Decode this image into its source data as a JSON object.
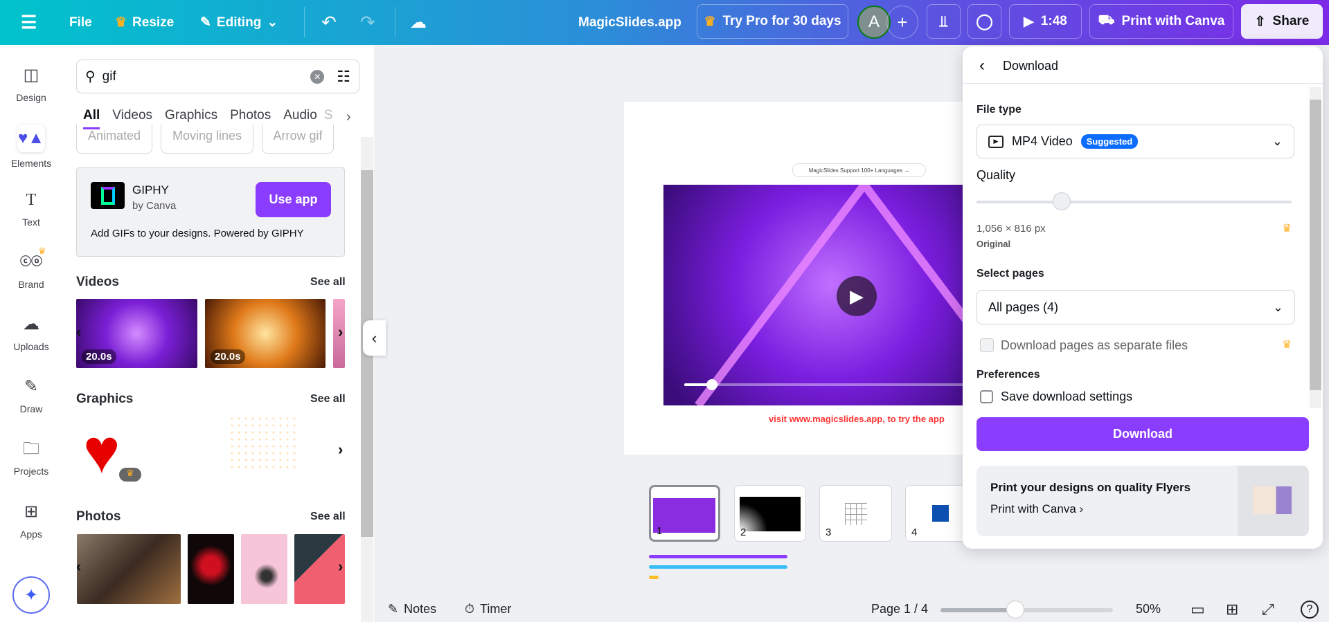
{
  "topbar": {
    "file": "File",
    "resize": "Resize",
    "editing": "Editing",
    "title": "MagicSlides.app",
    "try_pro": "Try Pro for 30 days",
    "avatar": "A",
    "timer": "1:48",
    "print": "Print with Canva",
    "share": "Share"
  },
  "rail": [
    {
      "label": "Design",
      "icon": "layout-icon"
    },
    {
      "label": "Elements",
      "icon": "elements-icon"
    },
    {
      "label": "Text",
      "icon": "text-icon"
    },
    {
      "label": "Brand",
      "icon": "brand-icon"
    },
    {
      "label": "Uploads",
      "icon": "upload-icon"
    },
    {
      "label": "Draw",
      "icon": "draw-icon"
    },
    {
      "label": "Projects",
      "icon": "folder-icon"
    },
    {
      "label": "Apps",
      "icon": "apps-icon"
    }
  ],
  "search": {
    "value": "gif"
  },
  "tabs": [
    "All",
    "Videos",
    "Graphics",
    "Photos",
    "Audio",
    "S"
  ],
  "chips": [
    "Animated",
    "Moving lines",
    "Arrow gif"
  ],
  "giphy": {
    "name": "GIPHY",
    "by": "by Canva",
    "button": "Use app",
    "desc": "Add GIFs to your designs. Powered by GIPHY"
  },
  "sections": {
    "videos": "Videos",
    "graphics": "Graphics",
    "photos": "Photos",
    "see_all": "See all"
  },
  "videos": [
    {
      "duration": "20.0s"
    },
    {
      "duration": "20.0s"
    }
  ],
  "slide": {
    "pill": "MagicSlides Support 100+ Languages →",
    "footer": "visit www.magicslides.app, to try the app",
    "video_progress": 0.08
  },
  "pages": [
    "1",
    "2",
    "3",
    "4"
  ],
  "bottom": {
    "notes": "Notes",
    "timer": "Timer",
    "page": "Page 1 / 4",
    "zoom": "50%",
    "zoom_value": 50
  },
  "download": {
    "title": "Download",
    "file_type_label": "File type",
    "file_type": "MP4 Video",
    "badge": "Suggested",
    "quality_label": "Quality",
    "quality_value": 0.27,
    "size": "1,056 × 816 px",
    "size_label": "Original",
    "pages_label": "Select pages",
    "pages": "All pages (4)",
    "separate": "Download pages as separate files",
    "prefs": "Preferences",
    "save": "Save download settings",
    "button": "Download",
    "promo_title": "Print your designs on quality Flyers",
    "promo_link": "Print with Canva"
  },
  "colors": {
    "accent": "#8b3dff",
    "badge": "#0b6cff",
    "footer_red": "#ff3131"
  }
}
